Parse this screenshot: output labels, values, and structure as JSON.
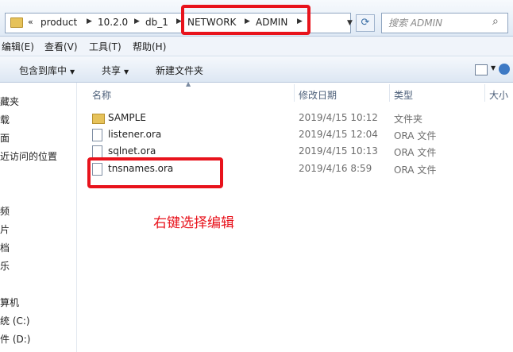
{
  "address_bar": {
    "overflow": "«",
    "crumbs": [
      "product",
      "10.2.0",
      "db_1",
      "NETWORK",
      "ADMIN"
    ],
    "refresh_icon": "refresh-icon"
  },
  "search": {
    "placeholder": "搜索 ADMIN"
  },
  "menu": [
    "编辑(E)",
    "查看(V)",
    "工具(T)",
    "帮助(H)"
  ],
  "toolbar": {
    "include_library": "包含到库中",
    "share": "共享",
    "new_folder": "新建文件夹"
  },
  "nav": [
    "藏夹",
    "载",
    "面",
    "近访问的位置",
    "频",
    "片",
    "档",
    "乐",
    "算机",
    "统 (C:)",
    "件 (D:)"
  ],
  "columns": {
    "name": "名称",
    "modified": "修改日期",
    "type": "类型",
    "size": "大小"
  },
  "files": [
    {
      "name": "SAMPLE",
      "date": "2019/4/15 10:12",
      "type": "文件夹",
      "icon": "folder-icon"
    },
    {
      "name": "listener.ora",
      "date": "2019/4/15 12:04",
      "type": "ORA 文件",
      "icon": "file-icon"
    },
    {
      "name": "sqlnet.ora",
      "date": "2019/4/15 10:13",
      "type": "ORA 文件",
      "icon": "file-icon"
    },
    {
      "name": "tnsnames.ora",
      "date": "2019/4/16 8:59",
      "type": "ORA 文件",
      "icon": "file-icon"
    }
  ],
  "annotation": {
    "note": "右键选择编辑",
    "color": "#e8131c"
  }
}
